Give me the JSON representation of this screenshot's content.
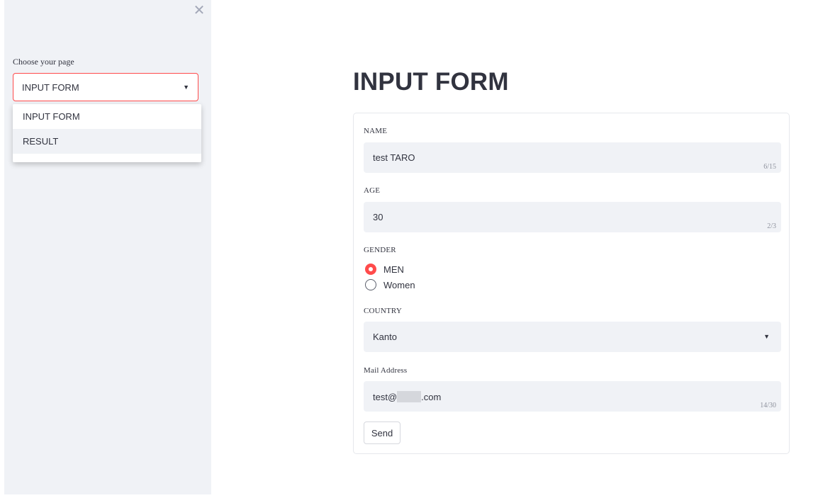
{
  "sidebar": {
    "close_glyph": "✕",
    "label": "Choose your page",
    "selected": "INPUT FORM",
    "options": [
      "INPUT FORM",
      "RESULT"
    ]
  },
  "main": {
    "title": "INPUT FORM",
    "form": {
      "name": {
        "label": "NAME",
        "value": "test TARO",
        "counter": "6/15"
      },
      "age": {
        "label": "AGE",
        "value": "30",
        "counter": "2/3"
      },
      "gender": {
        "label": "GENDER",
        "options": [
          "MEN",
          "Women"
        ],
        "selected": "MEN"
      },
      "country": {
        "label": "COUNTRY",
        "value": "Kanto"
      },
      "mail": {
        "label": "Mail Address",
        "value_prefix": "test@",
        "value_suffix": ".com",
        "counter": "14/30"
      },
      "send_label": "Send"
    }
  },
  "colors": {
    "accent": "#ff4b4b",
    "sidebar_bg": "#f0f2f6",
    "input_bg": "#f0f2f6",
    "text": "#31333f"
  },
  "icons": {
    "close": "close-icon",
    "dropdown": "chevron-down-icon"
  }
}
